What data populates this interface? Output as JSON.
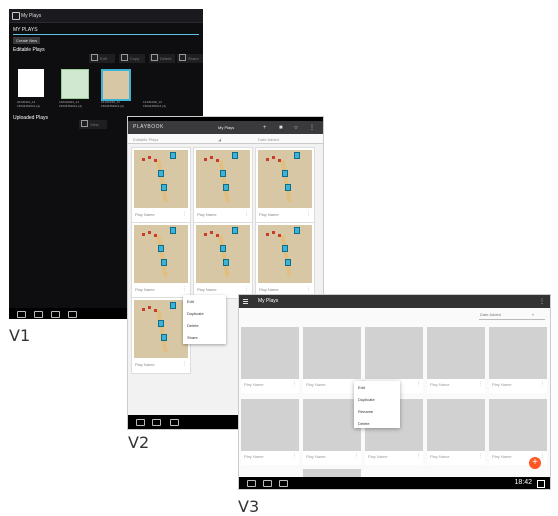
{
  "labels": {
    "v1": "V1",
    "v2": "V2",
    "v3": "V3"
  },
  "v1": {
    "title": "My Plays",
    "section": "MY PLAYS",
    "create_button": "Create New",
    "editable_heading": "Editable Plays",
    "toolbar": [
      "Edit",
      "Copy",
      "Delete",
      "Share"
    ],
    "thumbs": [
      {
        "caption": "20130410_14 15034452014.ply"
      },
      {
        "caption": "130410024_14 15034452014.ply"
      },
      {
        "caption": "1413044R_14 15034452014.ply"
      },
      {
        "caption": "1413044R_14 15034452014.ply"
      }
    ],
    "uploaded_heading": "Uploaded Plays",
    "uploaded_toolbar": [
      "View"
    ]
  },
  "v2": {
    "brand": "PLAYBOOK",
    "title": "My Plays",
    "filter_left": "Editable Plays",
    "filter_right": "Date Added",
    "card_name": "Play Name",
    "menu": [
      "Edit",
      "Duplicate",
      "Delete",
      "Share"
    ]
  },
  "v3": {
    "title": "My Plays",
    "sort": "Date Added",
    "card_name": "Play Name",
    "menu": [
      "Edit",
      "Duplicate",
      "Rename",
      "Delete"
    ],
    "fab": "+",
    "time": "18:42"
  },
  "colors": {
    "accent_blue": "#5fc0e8",
    "fab": "#ff5722",
    "map": "#d8c7a4"
  }
}
